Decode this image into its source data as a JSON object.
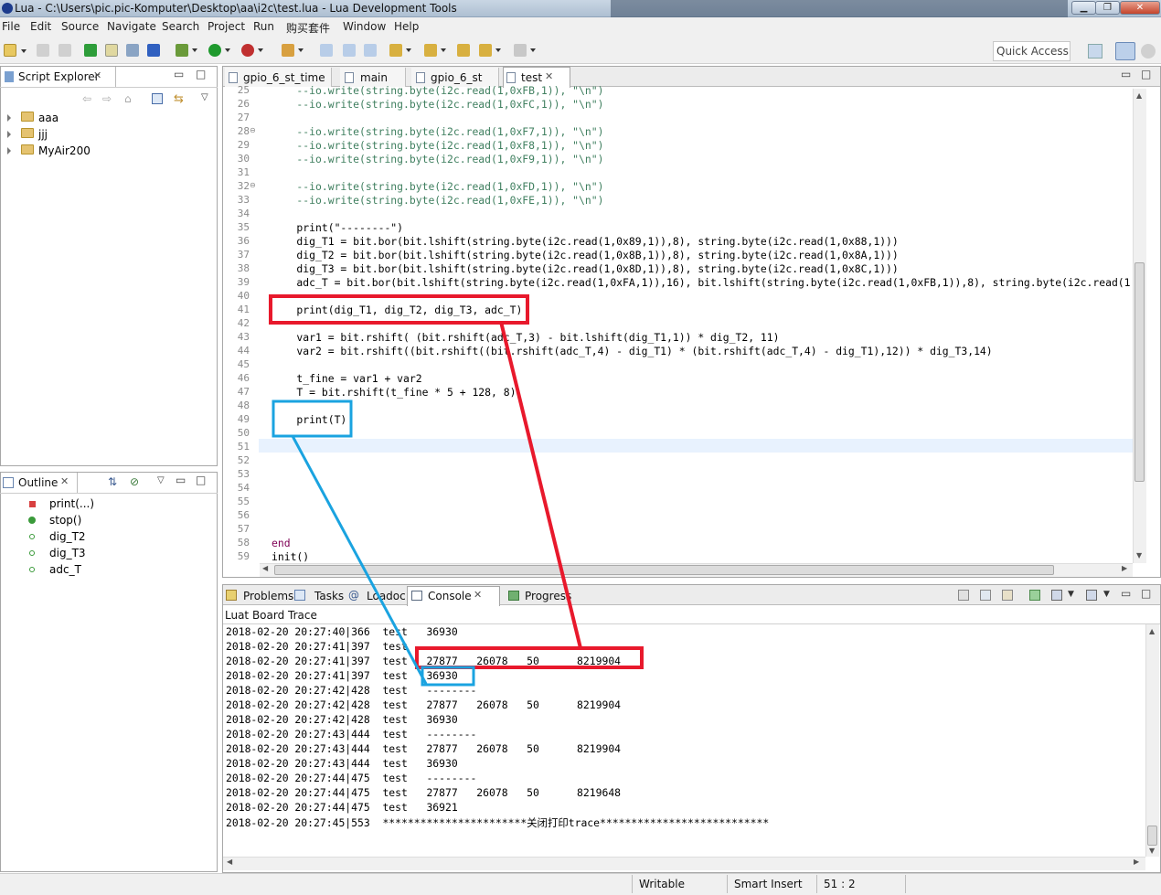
{
  "window": {
    "title": "Lua - C:\\Users\\pic.pic-Komputer\\Desktop\\aa\\i2c\\test.lua - Lua Development Tools"
  },
  "menu": [
    "File",
    "Edit",
    "Source",
    "Navigate",
    "Search",
    "Project",
    "Run",
    "购买套件",
    "Window",
    "Help"
  ],
  "quick_access": "Quick Access",
  "script_explorer": {
    "title": "Script Explorer",
    "items": [
      "aaa",
      "jjj",
      "MyAir200"
    ]
  },
  "outline": {
    "title": "Outline",
    "items": [
      "print(...)",
      "stop()",
      "dig_T2",
      "dig_T3",
      "adc_T"
    ]
  },
  "editor": {
    "tabs": [
      "gpio_6_st_time",
      "main",
      "gpio_6_st",
      "test"
    ],
    "active_tab": "test",
    "lines": [
      {
        "n": "25",
        "text": "    --io.write(string.byte(i2c.read(1,0xFB,1)), \"\\n\")",
        "cls": "cm"
      },
      {
        "n": "26",
        "text": "    --io.write(string.byte(i2c.read(1,0xFC,1)), \"\\n\")",
        "cls": "cm"
      },
      {
        "n": "27",
        "text": "",
        "cls": ""
      },
      {
        "n": "28",
        "text": "    --io.write(string.byte(i2c.read(1,0xF7,1)), \"\\n\")",
        "cls": "cm"
      },
      {
        "n": "29",
        "text": "    --io.write(string.byte(i2c.read(1,0xF8,1)), \"\\n\")",
        "cls": "cm"
      },
      {
        "n": "30",
        "text": "    --io.write(string.byte(i2c.read(1,0xF9,1)), \"\\n\")",
        "cls": "cm"
      },
      {
        "n": "31",
        "text": "",
        "cls": ""
      },
      {
        "n": "32",
        "text": "    --io.write(string.byte(i2c.read(1,0xFD,1)), \"\\n\")",
        "cls": "cm"
      },
      {
        "n": "33",
        "text": "    --io.write(string.byte(i2c.read(1,0xFE,1)), \"\\n\")",
        "cls": "cm"
      },
      {
        "n": "34",
        "text": "",
        "cls": ""
      },
      {
        "n": "35",
        "text": "    print(\"--------\")",
        "cls": ""
      },
      {
        "n": "36",
        "text": "    dig_T1 = bit.bor(bit.lshift(string.byte(i2c.read(1,0x89,1)),8), string.byte(i2c.read(1,0x88,1)))",
        "cls": ""
      },
      {
        "n": "37",
        "text": "    dig_T2 = bit.bor(bit.lshift(string.byte(i2c.read(1,0x8B,1)),8), string.byte(i2c.read(1,0x8A,1)))",
        "cls": ""
      },
      {
        "n": "38",
        "text": "    dig_T3 = bit.bor(bit.lshift(string.byte(i2c.read(1,0x8D,1)),8), string.byte(i2c.read(1,0x8C,1)))",
        "cls": ""
      },
      {
        "n": "39",
        "text": "    adc_T = bit.bor(bit.lshift(string.byte(i2c.read(1,0xFA,1)),16), bit.lshift(string.byte(i2c.read(1,0xFB,1)),8), string.byte(i2c.read(1",
        "cls": ""
      },
      {
        "n": "40",
        "text": "",
        "cls": ""
      },
      {
        "n": "41",
        "text": "    print(dig_T1, dig_T2, dig_T3, adc_T)",
        "cls": ""
      },
      {
        "n": "42",
        "text": "",
        "cls": ""
      },
      {
        "n": "43",
        "text": "    var1 = bit.rshift( (bit.rshift(adc_T,3) - bit.lshift(dig_T1,1)) * dig_T2, 11)",
        "cls": ""
      },
      {
        "n": "44",
        "text": "    var2 = bit.rshift((bit.rshift((bit.rshift(adc_T,4) - dig_T1) * (bit.rshift(adc_T,4) - dig_T1),12)) * dig_T3,14)",
        "cls": ""
      },
      {
        "n": "45",
        "text": "",
        "cls": ""
      },
      {
        "n": "46",
        "text": "    t_fine = var1 + var2",
        "cls": ""
      },
      {
        "n": "47",
        "text": "    T = bit.rshift(t_fine * 5 + 128, 8)",
        "cls": ""
      },
      {
        "n": "48",
        "text": "",
        "cls": ""
      },
      {
        "n": "49",
        "text": "    print(T)",
        "cls": ""
      },
      {
        "n": "50",
        "text": "",
        "cls": ""
      },
      {
        "n": "51",
        "text": "",
        "cls": ""
      },
      {
        "n": "52",
        "text": "",
        "cls": ""
      },
      {
        "n": "53",
        "text": "",
        "cls": ""
      },
      {
        "n": "54",
        "text": "",
        "cls": ""
      },
      {
        "n": "55",
        "text": "",
        "cls": ""
      },
      {
        "n": "56",
        "text": "",
        "cls": ""
      },
      {
        "n": "57",
        "text": "",
        "cls": ""
      },
      {
        "n": "58",
        "text": "end",
        "cls": "kw"
      },
      {
        "n": "59",
        "text": "init()",
        "cls": ""
      }
    ]
  },
  "bottom_tabs": [
    "Problems",
    "Tasks",
    "Loadoc",
    "Console",
    "Progress"
  ],
  "console": {
    "title": "Luat Board Trace",
    "lines": [
      "2018-02-20 20:27:40|366  test   36930",
      "2018-02-20 20:27:41|397  test   --------",
      "2018-02-20 20:27:41|397  test   27877   26078   50      8219904",
      "2018-02-20 20:27:41|397  test   36930",
      "2018-02-20 20:27:42|428  test   --------",
      "2018-02-20 20:27:42|428  test   27877   26078   50      8219904",
      "2018-02-20 20:27:42|428  test   36930",
      "2018-02-20 20:27:43|444  test   --------",
      "2018-02-20 20:27:43|444  test   27877   26078   50      8219904",
      "2018-02-20 20:27:43|444  test   36930",
      "2018-02-20 20:27:44|475  test   --------",
      "2018-02-20 20:27:44|475  test   27877   26078   50      8219648",
      "2018-02-20 20:27:44|475  test   36921",
      "2018-02-20 20:27:45|553  ***********************关闭打印trace***************************"
    ]
  },
  "status": {
    "writable": "Writable",
    "insert": "Smart Insert",
    "position": "51 : 2"
  },
  "annotation_colors": {
    "red": "#e8192c",
    "blue": "#1aa3e0"
  }
}
